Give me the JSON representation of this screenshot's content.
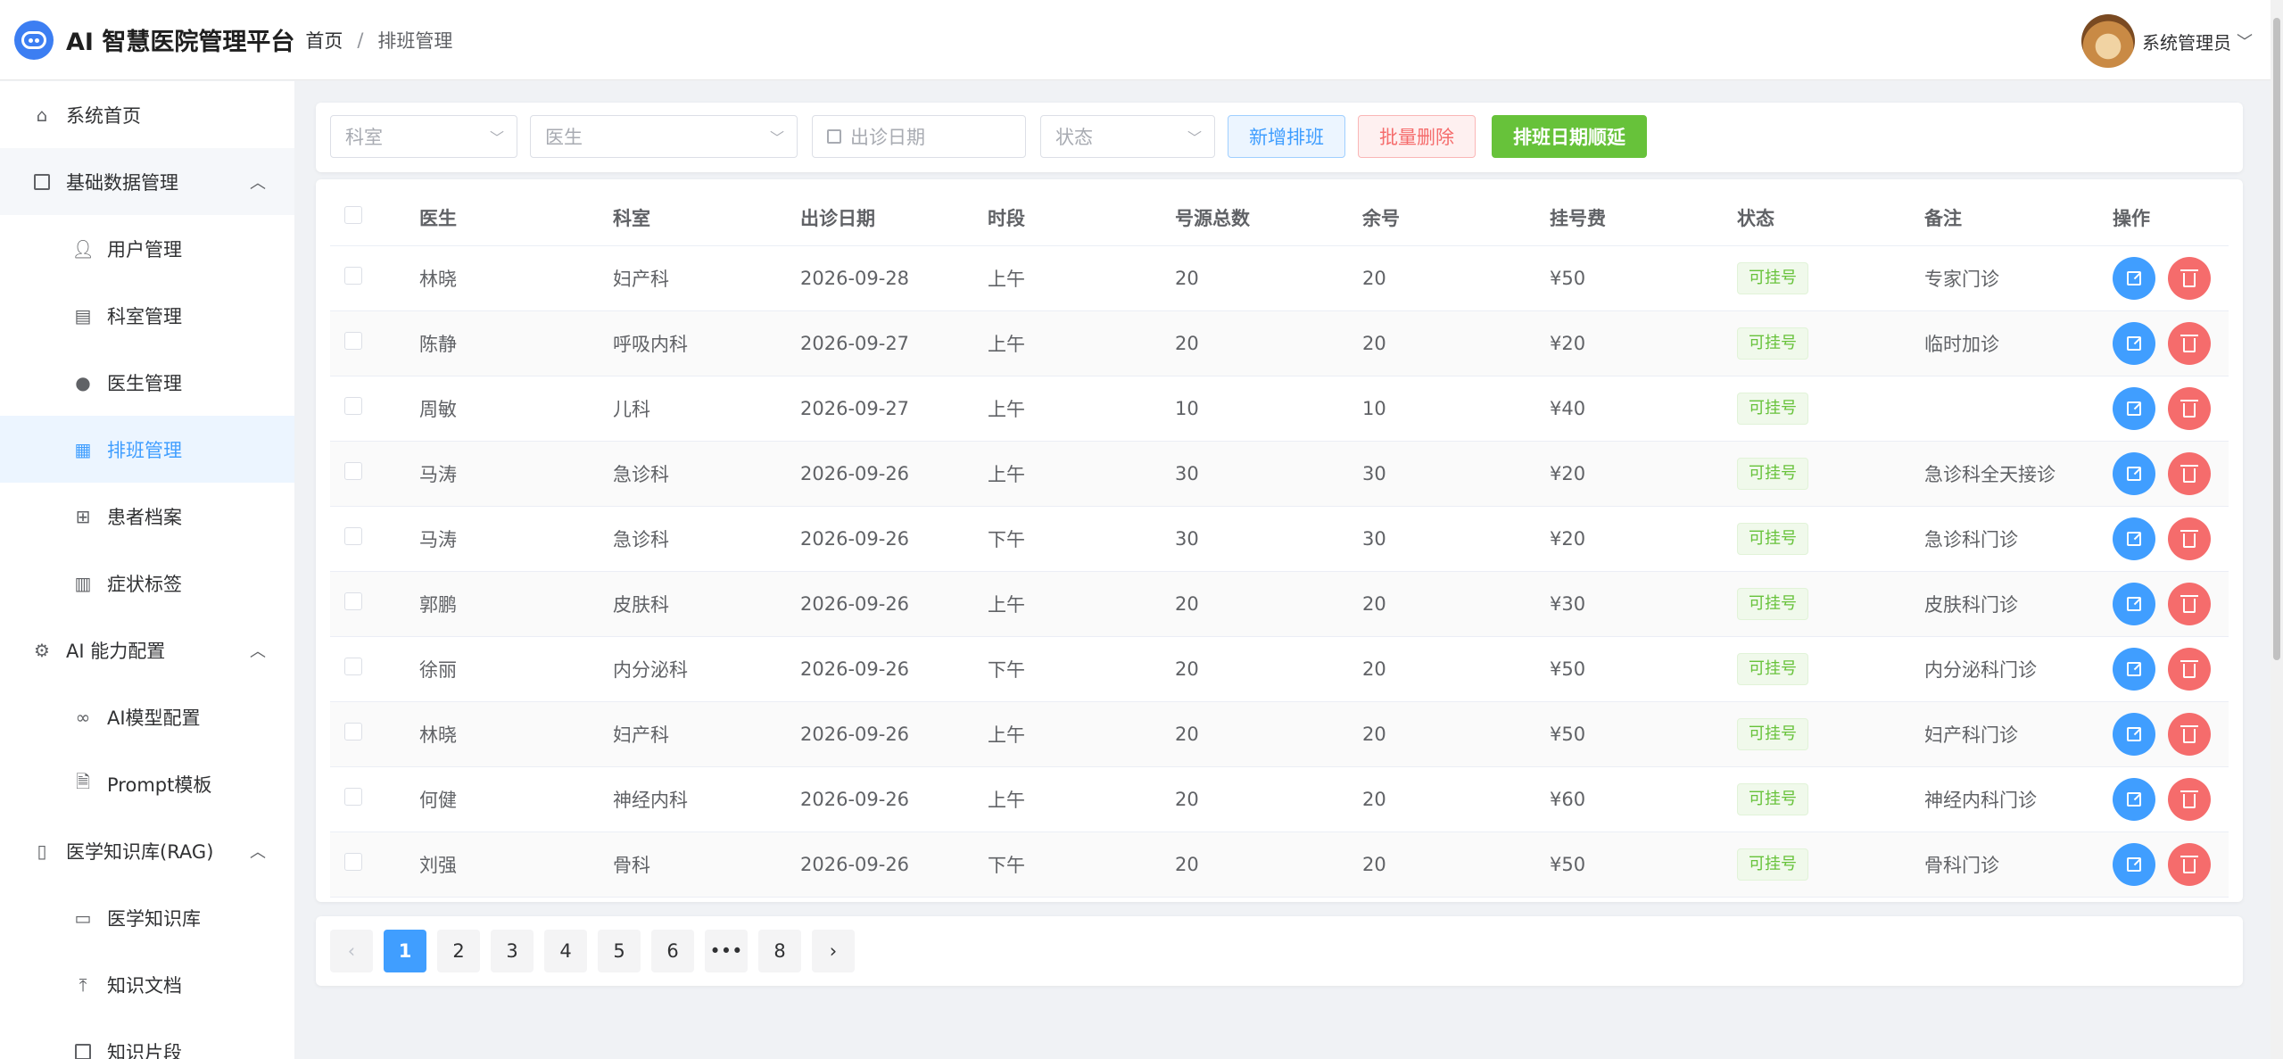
{
  "header": {
    "app_title": "AI 智慧医院管理平台",
    "breadcrumb": [
      "首页",
      "排班管理"
    ],
    "user_name": "系统管理员"
  },
  "sidebar": {
    "items": [
      {
        "label": "系统首页",
        "level": "top",
        "icon": "home-icon"
      },
      {
        "label": "基础数据管理",
        "level": "group",
        "icon": "box-icon"
      },
      {
        "label": "用户管理",
        "level": "sub",
        "icon": "user-icon"
      },
      {
        "label": "科室管理",
        "level": "sub",
        "icon": "building-icon"
      },
      {
        "label": "医生管理",
        "level": "sub",
        "icon": "doctor-icon"
      },
      {
        "label": "排班管理",
        "level": "sub",
        "icon": "calendar-icon",
        "active": true
      },
      {
        "label": "患者档案",
        "level": "sub",
        "icon": "medkit-icon"
      },
      {
        "label": "症状标签",
        "level": "sub",
        "icon": "notes-icon"
      },
      {
        "label": "AI 能力配置",
        "level": "group",
        "icon": "gear-icon"
      },
      {
        "label": "AI模型配置",
        "level": "sub",
        "icon": "link-icon"
      },
      {
        "label": "Prompt模板",
        "level": "sub",
        "icon": "document-icon"
      },
      {
        "label": "医学知识库(RAG)",
        "level": "group",
        "icon": "book-icon"
      },
      {
        "label": "医学知识库",
        "level": "sub",
        "icon": "bookmark-icon"
      },
      {
        "label": "知识文档",
        "level": "sub",
        "icon": "upload-icon"
      },
      {
        "label": "知识片段",
        "level": "sub",
        "icon": "box-icon"
      }
    ]
  },
  "filters": {
    "department_placeholder": "科室",
    "doctor_placeholder": "医生",
    "date_placeholder": "出诊日期",
    "status_placeholder": "状态",
    "add_label": "新增排班",
    "batch_delete_label": "批量删除",
    "postpone_label": "排班日期顺延"
  },
  "table": {
    "columns": [
      "医生",
      "科室",
      "出诊日期",
      "时段",
      "号源总数",
      "余号",
      "挂号费",
      "状态",
      "备注",
      "操作"
    ],
    "rows": [
      {
        "doctor": "林晓",
        "dept": "妇产科",
        "date": "2026-09-28",
        "period": "上午",
        "total": "20",
        "remain": "20",
        "fee": "¥50",
        "status": "可挂号",
        "note": "专家门诊"
      },
      {
        "doctor": "陈静",
        "dept": "呼吸内科",
        "date": "2026-09-27",
        "period": "上午",
        "total": "20",
        "remain": "20",
        "fee": "¥20",
        "status": "可挂号",
        "note": "临时加诊"
      },
      {
        "doctor": "周敏",
        "dept": "儿科",
        "date": "2026-09-27",
        "period": "上午",
        "total": "10",
        "remain": "10",
        "fee": "¥40",
        "status": "可挂号",
        "note": ""
      },
      {
        "doctor": "马涛",
        "dept": "急诊科",
        "date": "2026-09-26",
        "period": "上午",
        "total": "30",
        "remain": "30",
        "fee": "¥20",
        "status": "可挂号",
        "note": "急诊科全天接诊"
      },
      {
        "doctor": "马涛",
        "dept": "急诊科",
        "date": "2026-09-26",
        "period": "下午",
        "total": "30",
        "remain": "30",
        "fee": "¥20",
        "status": "可挂号",
        "note": "急诊科门诊"
      },
      {
        "doctor": "郭鹏",
        "dept": "皮肤科",
        "date": "2026-09-26",
        "period": "上午",
        "total": "20",
        "remain": "20",
        "fee": "¥30",
        "status": "可挂号",
        "note": "皮肤科门诊"
      },
      {
        "doctor": "徐丽",
        "dept": "内分泌科",
        "date": "2026-09-26",
        "period": "下午",
        "total": "20",
        "remain": "20",
        "fee": "¥50",
        "status": "可挂号",
        "note": "内分泌科门诊"
      },
      {
        "doctor": "林晓",
        "dept": "妇产科",
        "date": "2026-09-26",
        "period": "上午",
        "total": "20",
        "remain": "20",
        "fee": "¥50",
        "status": "可挂号",
        "note": "妇产科门诊"
      },
      {
        "doctor": "何健",
        "dept": "神经内科",
        "date": "2026-09-26",
        "period": "上午",
        "total": "20",
        "remain": "20",
        "fee": "¥60",
        "status": "可挂号",
        "note": "神经内科门诊"
      },
      {
        "doctor": "刘强",
        "dept": "骨科",
        "date": "2026-09-26",
        "period": "下午",
        "total": "20",
        "remain": "20",
        "fee": "¥50",
        "status": "可挂号",
        "note": "骨科门诊"
      }
    ]
  },
  "pagination": {
    "pages": [
      "1",
      "2",
      "3",
      "4",
      "5",
      "6",
      "•••",
      "8"
    ],
    "current": "1",
    "prev": "‹",
    "next": "›"
  },
  "colors": {
    "primary": "#409eff",
    "danger": "#f56c6c",
    "success": "#67c23a"
  }
}
